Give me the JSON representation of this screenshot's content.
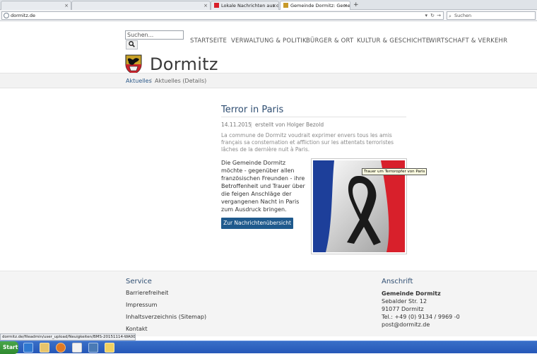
{
  "browser": {
    "tabs": [
      {
        "label": ""
      },
      {
        "label": ""
      },
      {
        "label": "Lokale Nachrichten aus de..."
      },
      {
        "label": "Gemeinde Dormitz: Gemei..."
      }
    ],
    "url": "dormitz.de",
    "search_placeholder": "Suchen"
  },
  "site": {
    "search_placeholder": "Suchen...",
    "nav": [
      "STARTSEITE",
      "VERWALTUNG & POLITIK",
      "BÜRGER & ORT",
      "KULTUR & GESCHICHTE",
      "WIRTSCHAFT & VERKEHR"
    ],
    "logo_text": "Dormitz",
    "breadcrumb": {
      "first": "Aktuelles",
      "sep": "/",
      "second": "Aktuelles (Details)"
    }
  },
  "article": {
    "title": "Terror in Paris",
    "date": "14.11.2015",
    "author": "erstellt von Holger Bezold",
    "intro": "La commune de Dormitz voudrait exprimer envers tous les amis français sa consternation et affliction sur les attentats terroristes lâches de la dernière nuit à Paris.",
    "body": "Die Gemeinde Dormitz möchte - gegenüber allen französischen Freunden - ihre Betroffenheit und Trauer über die feigen Anschläge der vergangenen Nacht in Paris zum Ausdruck bringen.",
    "back_button": "Zur Nachrichtenübersicht",
    "image_tooltip": "Trauer um Terroropfer von Paris"
  },
  "footer": {
    "service_title": "Service",
    "links": [
      "Barrierefreiheit",
      "Impressum",
      "Inhaltsverzeichnis (Sitemap)",
      "Kontakt"
    ],
    "address_title": "Anschrift",
    "address_lines": [
      "Gemeinde Dormitz",
      "Sebalder Str. 12",
      "91077 Dormitz",
      "Tel.: +49 (0) 9134 / 9969 -0",
      "post@dormitz.de"
    ]
  },
  "statusbar": {
    "text": "dormitz.de/fileadmin/user_upload/Neuigkeiten/BMS-20151114-WA0000.jpg"
  },
  "taskbar": {
    "start_label": "Start"
  },
  "colors": {
    "accent": "#1f5a8d",
    "heading": "#2f4e72",
    "flag_blue": "#1d3f9a",
    "flag_red": "#d8202b"
  }
}
